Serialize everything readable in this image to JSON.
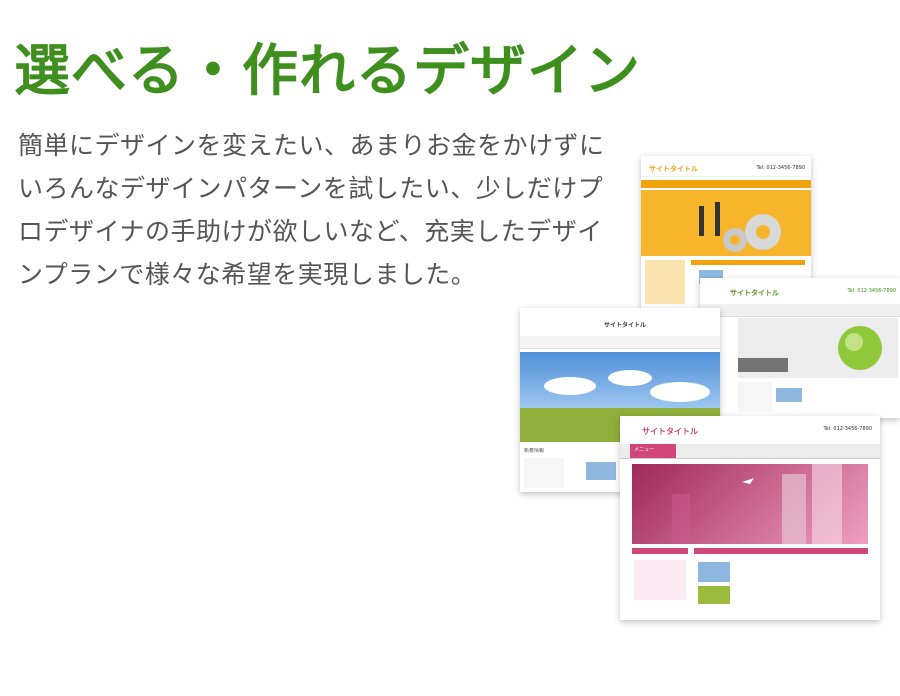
{
  "heading": "選べる・作れるデザイン",
  "body_text": "簡単にデザインを変えたい、あまりお金をかけずにいろんなデザインパターンを試したい、少しだけプロデザイナの手助けが欲しいなど、充実したデザインプランで様々な希望を実現しました。",
  "mockups": {
    "site_title": "サイトタイトル",
    "phone": "Tel: 012-3456-7890",
    "menu_label": "メニュー",
    "sidebar_label": "新着情報",
    "colors": {
      "accent": "#3f8f1f",
      "orange": "#f2a20c",
      "pink": "#d0457a",
      "sky": "#6aa8e0",
      "grass": "#9bbb3c"
    }
  }
}
